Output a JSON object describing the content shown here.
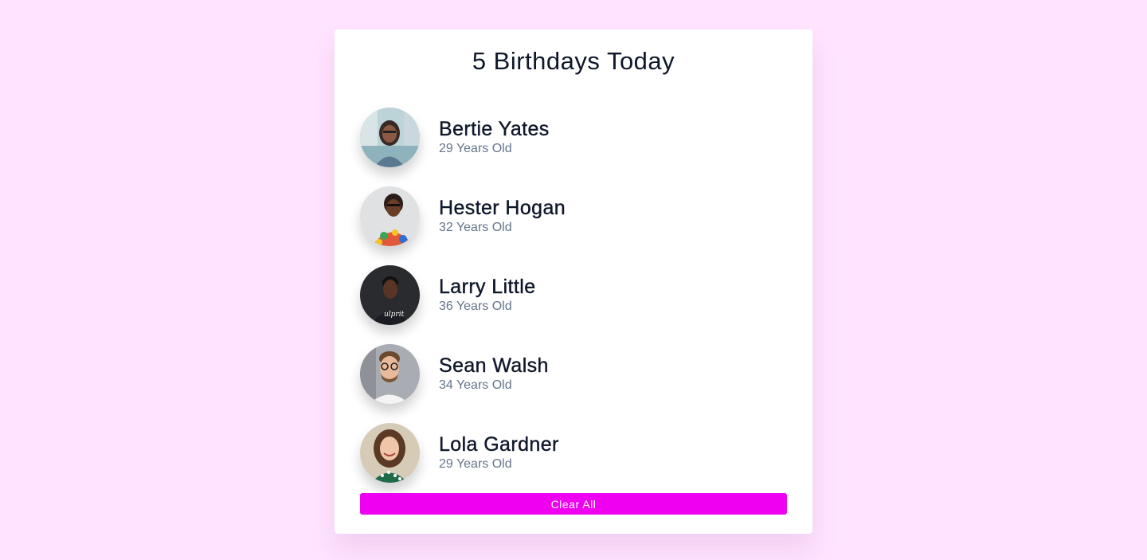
{
  "header": {
    "title": "5 Birthdays Today"
  },
  "people": [
    {
      "name": "Bertie Yates",
      "age": "29 Years Old",
      "avatar": "woman-city-photo-icon"
    },
    {
      "name": "Hester Hogan",
      "age": "32 Years Old",
      "avatar": "woman-colorful-shirt-photo-icon"
    },
    {
      "name": "Larry Little",
      "age": "36 Years Old",
      "avatar": "man-dark-shirt-photo-icon"
    },
    {
      "name": "Sean Walsh",
      "age": "34 Years Old",
      "avatar": "man-glasses-photo-icon"
    },
    {
      "name": "Lola Gardner",
      "age": "29 Years Old",
      "avatar": "woman-curly-hair-photo-icon"
    }
  ],
  "actions": {
    "clear_label": "Clear All"
  },
  "colors": {
    "background": "#ffe3ff",
    "card": "#ffffff",
    "accent": "#f000f0",
    "heading": "#0f172a",
    "muted": "#64748b"
  }
}
